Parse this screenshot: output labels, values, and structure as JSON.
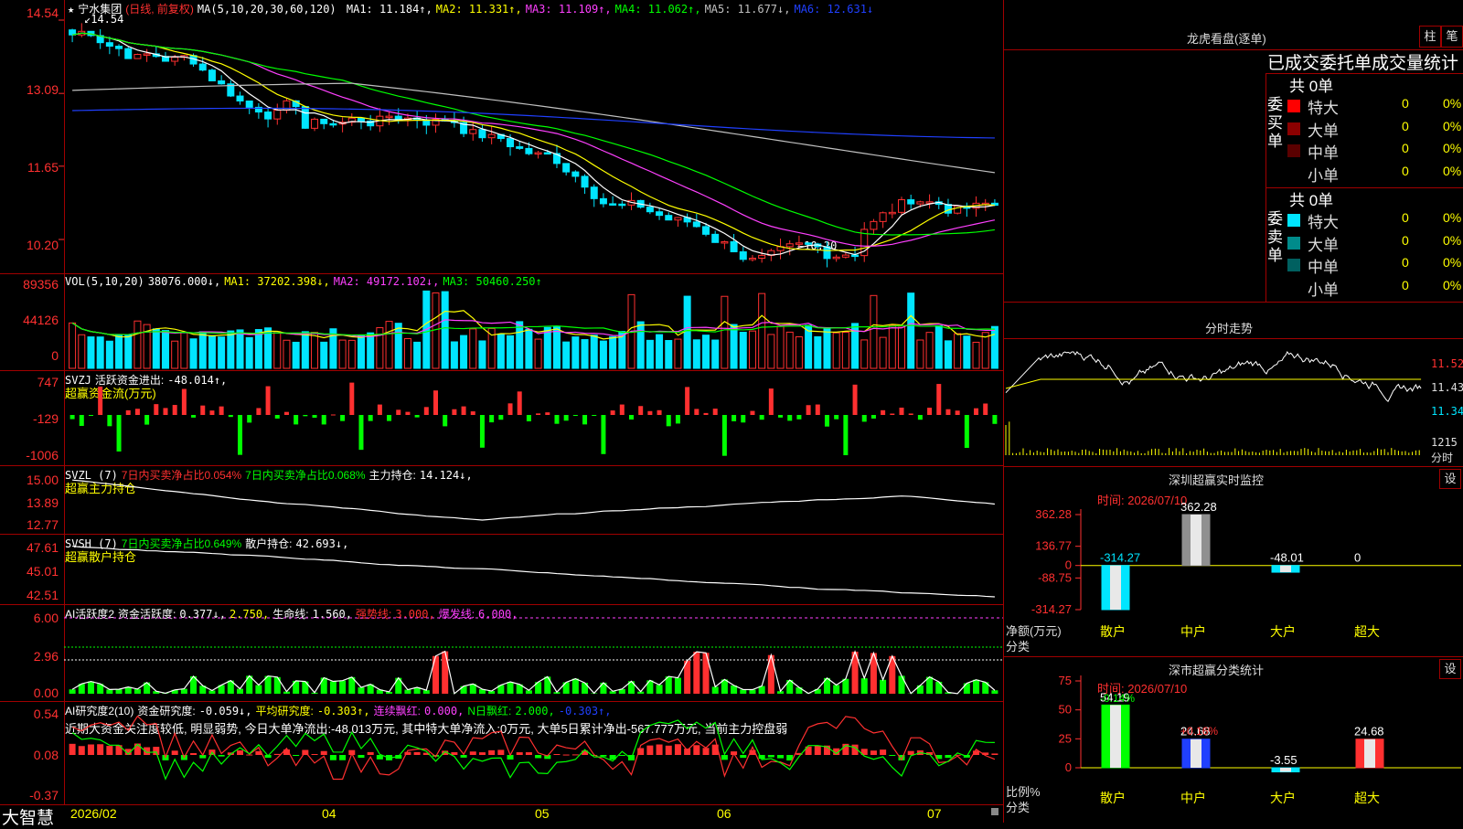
{
  "colors": {
    "up": "#ff3030",
    "down": "#00e5ff",
    "grid": "#a00000",
    "yellow": "#ffff00",
    "white": "#ffffff",
    "magenta": "#ff40ff",
    "green": "#00ff00",
    "gray": "#c0c0c0",
    "blue": "#2040ff",
    "label": "#ff3030"
  },
  "app": {
    "brand": "大智慧",
    "star": "★",
    "nav_left": "◀",
    "nav_right": "▶"
  },
  "main": {
    "stock": "宁水集团",
    "mode": "(日线, 前复权)",
    "ma_label": "MA(5,10,20,30,60,120)",
    "ma": [
      {
        "name": "MA1:",
        "value": "11.184↑,",
        "color": "#ffffff"
      },
      {
        "name": "MA2:",
        "value": "11.331↑,",
        "color": "#ffff00"
      },
      {
        "name": "MA3:",
        "value": "11.109↑,",
        "color": "#ff40ff"
      },
      {
        "name": "MA4:",
        "value": "11.062↑,",
        "color": "#00ff00"
      },
      {
        "name": "MA5:",
        "value": "11.677↓,",
        "color": "#c0c0c0"
      },
      {
        "name": "MA6:",
        "value": "12.631↓",
        "color": "#2040ff"
      }
    ],
    "yticks": [
      "14.54",
      "13.09",
      "11.65",
      "10.20"
    ],
    "high_label": "14.54",
    "low_label": "10.20"
  },
  "vol": {
    "label": "VOL(5,10,20)",
    "value": "38076.000↓,",
    "ma": [
      {
        "name": "MA1:",
        "value": "37202.398↓,",
        "color": "#ffff00"
      },
      {
        "name": "MA2:",
        "value": "49172.102↓,",
        "color": "#ff40ff"
      },
      {
        "name": "MA3:",
        "value": "50460.250↑",
        "color": "#00ff00"
      }
    ],
    "yticks": [
      "89356",
      "44126",
      "0"
    ]
  },
  "svzj": {
    "label": "SVZJ",
    "name": "活跃资金进出:",
    "value": "-48.014↑,",
    "sub": "超赢资金流(万元)",
    "yticks": [
      "747",
      "-129",
      "-1006"
    ]
  },
  "svzl": {
    "label": "SVZL (7)",
    "a": "7日内买卖净占比0.054%",
    "b": "7日内买卖净占比0.068%",
    "c_name": "主力持仓:",
    "c_val": "14.124↓,",
    "sub": "超赢主力持仓",
    "yticks": [
      "15.00",
      "13.89",
      "12.77"
    ]
  },
  "svsh": {
    "label": "SVSH (7)",
    "a": "7日内买卖净占比0.649%",
    "c_name": "散户持仓:",
    "c_val": "42.693↓,",
    "sub": "超赢散户持仓",
    "yticks": [
      "47.61",
      "45.01",
      "42.51"
    ]
  },
  "ai1": {
    "label": "AI活跃度2",
    "a": "资金活跃度:",
    "a_val": "0.377↓,",
    "b_val": "2.750,",
    "c": "生命线:",
    "c_val": "1.560,",
    "d": "强势线:",
    "d_val": "3.000,",
    "e": "爆发线:",
    "e_val": "6.000,",
    "yticks": [
      "6.00",
      "2.96",
      "0.00"
    ]
  },
  "ai2": {
    "label": "AI研究度2(10)",
    "a": "资金研究度:",
    "a_val": "-0.059↓,",
    "b": "平均研究度:",
    "b_val": "-0.303↑,",
    "c": "连续飘红:",
    "c_val": "0.000,",
    "d": "N日飘红:",
    "d_val": "2.000,",
    "e_val": "-0.303↑,",
    "comment": "近期大资金关注度较低, 明显弱势, 今日大单净流出:-48.013万元, 其中特大单净流入:0万元, 大单5日累计净出-567.777万元, 当前主力控盘弱",
    "yticks": [
      "0.54",
      "0.08",
      "-0.37"
    ]
  },
  "xaxis": [
    "2026/02",
    "04",
    "05",
    "06",
    "07"
  ],
  "longhu": {
    "title": "龙虎看盘(逐单)",
    "btn_a": "柱",
    "btn_b": "笔",
    "header": "已成交委托单成交量统计",
    "buy": {
      "side": "委买单",
      "total": "共 0单",
      "rows": [
        {
          "name": "特大",
          "v1": "0",
          "v2": "0%",
          "color": "#ff0000"
        },
        {
          "name": "大单",
          "v1": "0",
          "v2": "0%",
          "color": "#8b0000"
        },
        {
          "name": "中单",
          "v1": "0",
          "v2": "0%",
          "color": "#5a0000"
        },
        {
          "name": "小单",
          "v1": "0",
          "v2": "0%",
          "color": "#000000"
        }
      ]
    },
    "sell": {
      "side": "委卖单",
      "total": "共 0单",
      "rows": [
        {
          "name": "特大",
          "v1": "0",
          "v2": "0%",
          "color": "#00e5ff"
        },
        {
          "name": "大单",
          "v1": "0",
          "v2": "0%",
          "color": "#008b8b"
        },
        {
          "name": "中单",
          "v1": "0",
          "v2": "0%",
          "color": "#006060"
        },
        {
          "name": "小单",
          "v1": "0",
          "v2": "0%",
          "color": "#000000"
        }
      ]
    }
  },
  "intraday": {
    "title": "分时走势",
    "yticks": [
      "11.52",
      "11.43",
      "11.34"
    ],
    "vol_tick": "1215",
    "fs": "分时"
  },
  "sz_monitor": {
    "title": "深圳超赢实时监控",
    "btn": "设",
    "time": "时间: 2026/07/10",
    "yticks": [
      "362.28",
      "136.77",
      "0",
      "-88.75",
      "-314.27"
    ],
    "ylabel": "净额(万元)",
    "xlabel": "分类",
    "categories": [
      "散户",
      "中户",
      "大户",
      "超大"
    ],
    "values": [
      "-314.27",
      "362.28",
      "-48.01",
      "0"
    ]
  },
  "sh_stat": {
    "title": "深市超赢分类统计",
    "btn": "设",
    "time": "时间: 2026/07/10",
    "yticks": [
      "75",
      "50",
      "25",
      "0"
    ],
    "ylabel": "比例%",
    "xlabel": "分类",
    "categories": [
      "散户",
      "中户",
      "大户",
      "超大"
    ],
    "values": [
      "54.19",
      "24.68",
      "-3.55",
      "24.68"
    ],
    "top_labels": [
      "-0.14%",
      "+0.16%",
      "",
      ""
    ]
  }
}
